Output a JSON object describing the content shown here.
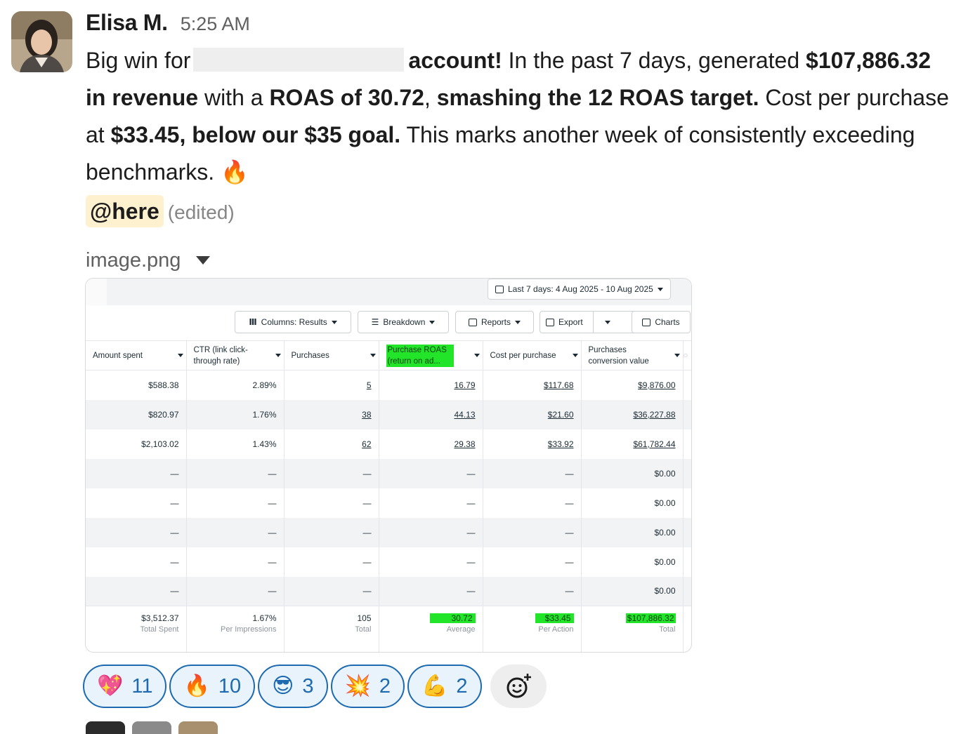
{
  "message": {
    "author": "Elisa M.",
    "time": "5:25 AM",
    "text": {
      "p1": "Big win for",
      "p2": "account!",
      "p3": "In the past 7 days,  generated",
      "p4": "$107,886.32 in revenue",
      "p5": "with a",
      "p6": "ROAS of 30.72",
      "p7": ",",
      "p8": "smashing the 12 ROAS target.",
      "p9": "Cost per purchase at",
      "p10": "$33.45, below our $35  goal.",
      "p11": "This marks another week of consistently exceeding benchmarks.",
      "emoji": "🔥"
    },
    "mention": "@here",
    "edited": "(edited)",
    "file_name": "image.png"
  },
  "screenshot": {
    "date_range": "Last 7 days: 4 Aug 2025 - 10 Aug 2025",
    "toolbar": {
      "columns": "Columns: Results",
      "breakdown": "Breakdown",
      "reports": "Reports",
      "export": "Export",
      "charts": "Charts"
    },
    "columns": [
      "Amount spent",
      "CTR (link click-through rate)",
      "Purchases",
      "Purchase ROAS (return on ad...",
      "Cost per purchase",
      "Purchases conversion value"
    ],
    "rows": [
      [
        "$588.38",
        "2.89%",
        "5",
        "16.79",
        "$117.68",
        "$9,876.00"
      ],
      [
        "$820.97",
        "1.76%",
        "38",
        "44.13",
        "$21.60",
        "$36,227.88"
      ],
      [
        "$2,103.02",
        "1.43%",
        "62",
        "29.38",
        "$33.92",
        "$61,782.44"
      ],
      [
        "—",
        "—",
        "—",
        "—",
        "—",
        "$0.00"
      ],
      [
        "—",
        "—",
        "—",
        "—",
        "—",
        "$0.00"
      ],
      [
        "—",
        "—",
        "—",
        "—",
        "—",
        "$0.00"
      ],
      [
        "—",
        "—",
        "—",
        "—",
        "—",
        "$0.00"
      ],
      [
        "—",
        "—",
        "—",
        "—",
        "—",
        "$0.00"
      ]
    ],
    "totals": [
      {
        "value": "$3,512.37",
        "label": "Total Spent"
      },
      {
        "value": "1.67%",
        "label": "Per Impressions"
      },
      {
        "value": "105",
        "label": "Total"
      },
      {
        "value": "30.72",
        "label": "Average"
      },
      {
        "value": "$33.45",
        "label": "Per Action"
      },
      {
        "value": "$107,886.32",
        "label": "Total"
      }
    ]
  },
  "reactions": [
    {
      "emoji": "💖",
      "count": "11"
    },
    {
      "emoji": "🔥",
      "count": "10"
    },
    {
      "emoji": "😎",
      "count": "3"
    },
    {
      "emoji": "💥",
      "count": "2"
    },
    {
      "emoji": "💪",
      "count": "2"
    }
  ],
  "colors": {
    "accent": "#1d6ab0",
    "highlight": "#22e52a",
    "mention_bg": "#fdf1cf"
  }
}
